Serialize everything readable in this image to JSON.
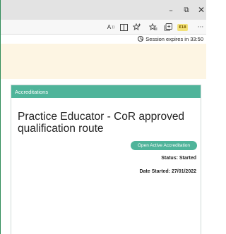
{
  "window": {
    "minimize_glyph": "–",
    "maximize_glyph": "⧉",
    "close_glyph": "✕"
  },
  "toolbar": {
    "read_aloud_glyph": "A",
    "icons": [
      "read-aloud-icon",
      "immersive-reader-icon",
      "add-favorite-icon",
      "favorites-icon",
      "collections-icon",
      "extension-icon",
      "more-icon"
    ],
    "ext_label": "E18",
    "more_glyph": "···"
  },
  "session": {
    "text": "Session expires in 33:50"
  },
  "card": {
    "header": "Accreditations",
    "title": "Practice Educator - CoR approved qualification route",
    "open_button": "Open Active Accreditation",
    "status": "Status: Started",
    "date_started": "Date Started: 27/01/2022"
  },
  "colors": {
    "accent": "#4fb49a",
    "banner": "#fdf5e3",
    "titlebar": "#e3e3e3"
  }
}
